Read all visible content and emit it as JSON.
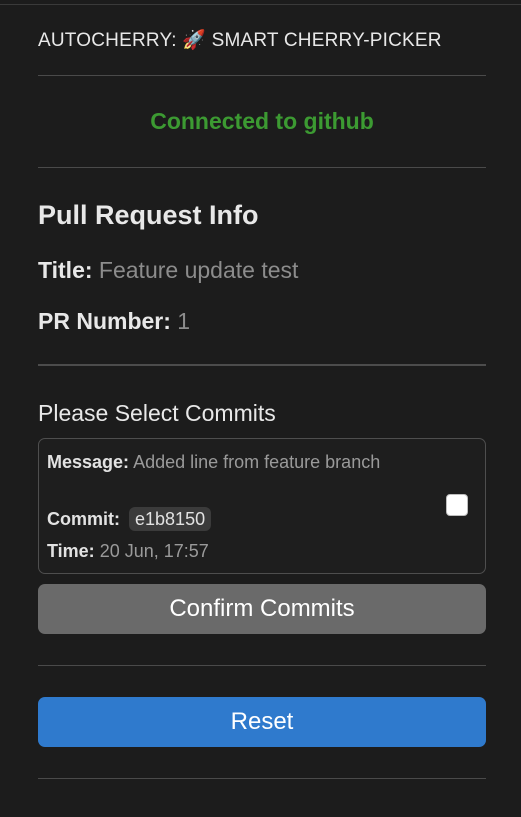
{
  "header": {
    "title": "AUTOCHERRY: 🚀 SMART CHERRY-PICKER"
  },
  "connection": {
    "status": "Connected to github",
    "status_color": "#3c9a32"
  },
  "pr_info": {
    "heading": "Pull Request Info",
    "title_label": "Title:",
    "title_value": "Feature update test",
    "number_label": "PR Number:",
    "number_value": "1"
  },
  "commits_section": {
    "heading": "Please Select Commits",
    "commits": [
      {
        "message_label": "Message:",
        "message": "Added line from feature branch",
        "commit_label": "Commit:",
        "sha": "e1b8150",
        "time_label": "Time:",
        "time": "20 Jun, 17:57",
        "selected": false
      }
    ],
    "confirm_label": "Confirm Commits"
  },
  "actions": {
    "reset_label": "Reset",
    "reset_color": "#2f7acd"
  },
  "icons": {
    "checkbox": "checkbox-icon"
  }
}
